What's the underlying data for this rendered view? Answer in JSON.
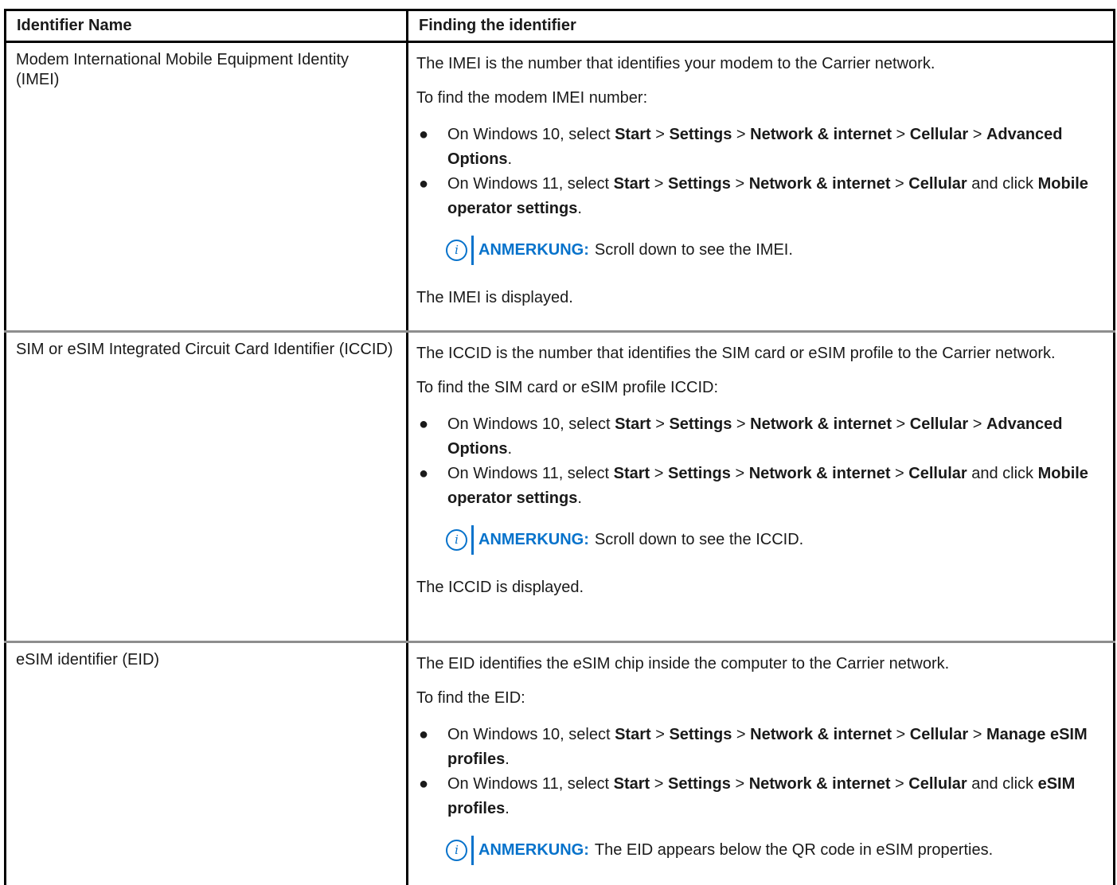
{
  "header": {
    "col1": "Identifier Name",
    "col2": "Finding the identifier"
  },
  "rows": [
    {
      "name": "Modem International Mobile Equipment Identity (IMEI)",
      "intro": "The IMEI is the number that identifies your modem to the Carrier network.",
      "find": "To find the modem IMEI number:",
      "w10": {
        "prefix": "On Windows 10, select ",
        "start": "Start",
        "settings": "Settings",
        "network": "Network & internet",
        "cellular": "Cellular",
        "target": "Advanced Options"
      },
      "w11": {
        "prefix": "On Windows 11, select ",
        "start": "Start",
        "settings": "Settings",
        "network": "Network & internet",
        "cellular": "Cellular",
        "click": " and click ",
        "target": "Mobile operator settings"
      },
      "note_label": "ANMERKUNG:",
      "note_text": "Scroll down to see the IMEI.",
      "tail": "The IMEI is displayed."
    },
    {
      "name": "SIM or eSIM Integrated Circuit Card Identifier (ICCID)",
      "intro": "The ICCID is the number that identifies the SIM card or eSIM profile to the Carrier network.",
      "find": "To find the SIM card or eSIM profile ICCID:",
      "w10": {
        "prefix": "On Windows 10, select ",
        "start": "Start",
        "settings": "Settings",
        "network": "Network & internet",
        "cellular": "Cellular",
        "target": "Advanced Options"
      },
      "w11": {
        "prefix": "On Windows 11, select ",
        "start": "Start",
        "settings": "Settings",
        "network": "Network & internet",
        "cellular": "Cellular",
        "click": " and click ",
        "target": "Mobile operator settings"
      },
      "note_label": "ANMERKUNG:",
      "note_text": "Scroll down to see the ICCID.",
      "tail": "The ICCID is displayed."
    },
    {
      "name": "eSIM identifier (EID)",
      "intro": "The EID identifies the eSIM chip inside the computer to the Carrier network.",
      "find": "To find the EID:",
      "w10": {
        "prefix": "On Windows 10, select ",
        "start": "Start",
        "settings": "Settings",
        "network": "Network & internet",
        "cellular": "Cellular",
        "target": "Manage eSIM profiles"
      },
      "w11": {
        "prefix": "On Windows 11, select ",
        "start": "Start",
        "settings": "Settings",
        "network": "Network & internet",
        "cellular": "Cellular",
        "click": " and click ",
        "target": "eSIM profiles"
      },
      "note_label": "ANMERKUNG:",
      "note_text": "The EID appears below the QR code in eSIM properties."
    }
  ],
  "symbols": {
    "bullet": "●",
    "separator": " > ",
    "period": ".",
    "info_glyph": "i"
  },
  "colors": {
    "note_accent": "#0672cb",
    "row_divider": "#8e8e8e",
    "border": "#000000"
  }
}
